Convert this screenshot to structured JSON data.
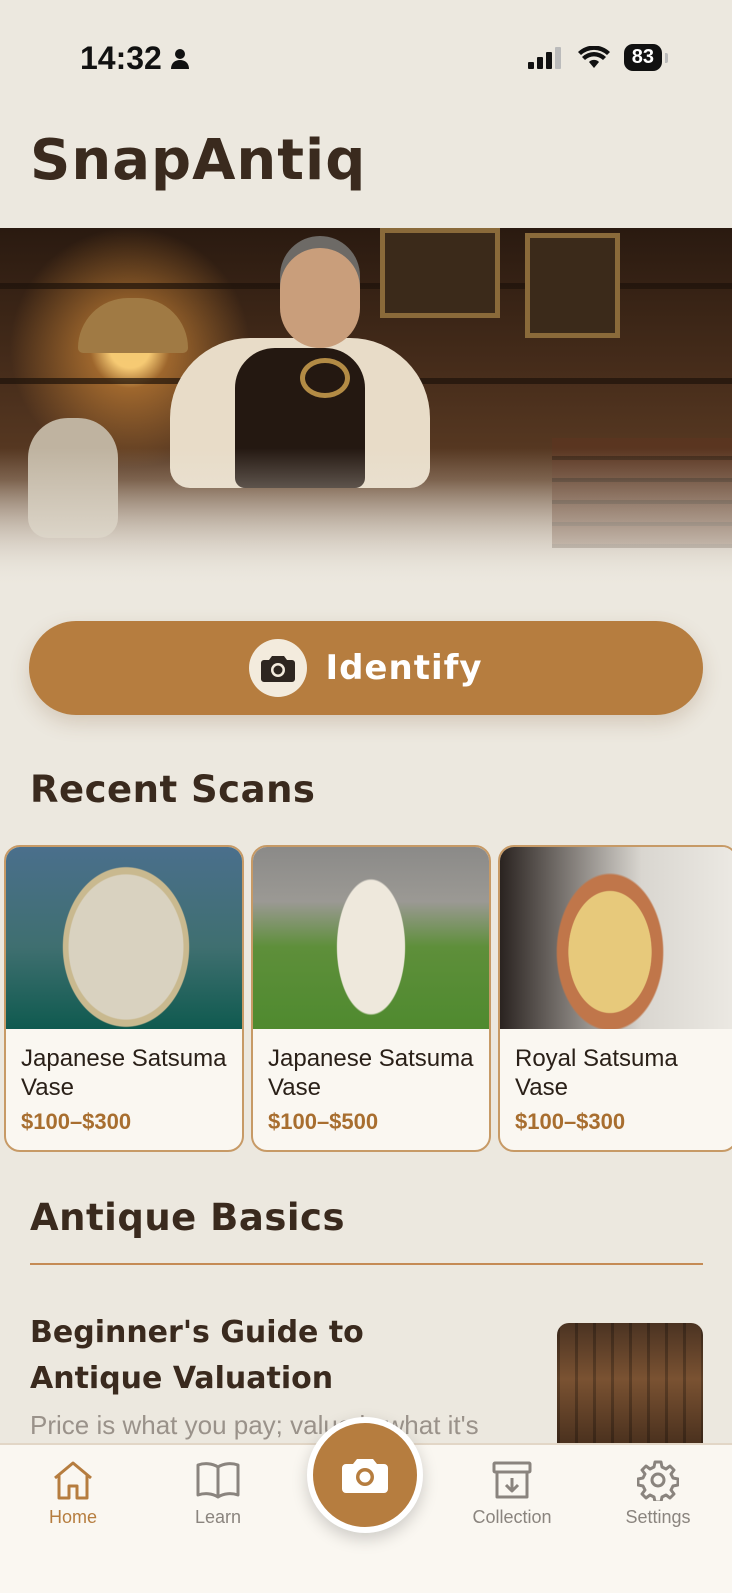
{
  "status_bar": {
    "time": "14:32",
    "battery": "83"
  },
  "header": {
    "title": "SnapAntiq"
  },
  "identify": {
    "label": "Identify"
  },
  "recent": {
    "title": "Recent Scans",
    "cards": [
      {
        "title": "Japanese Satsuma Vase",
        "price": "$100–$300"
      },
      {
        "title": "Japanese Satsuma Vase",
        "price": "$100–$500"
      },
      {
        "title": "Royal Satsuma Vase",
        "price": "$100–$300"
      }
    ]
  },
  "basics": {
    "title": "Antique Basics",
    "article": {
      "title": "Beginner's Guide to Antique Valuation",
      "snippet": "Price is what you pay; value is what it's"
    }
  },
  "tabbar": {
    "items": [
      {
        "label": "Home",
        "icon": "home-icon",
        "active": true
      },
      {
        "label": "Learn",
        "icon": "book-icon",
        "active": false
      },
      {
        "label": "Collection",
        "icon": "archive-icon",
        "active": false
      },
      {
        "label": "Settings",
        "icon": "gear-icon",
        "active": false
      }
    ]
  },
  "colors": {
    "accent": "#B67D3F",
    "background": "#ECE8DF",
    "text": "#3A2A1E"
  }
}
